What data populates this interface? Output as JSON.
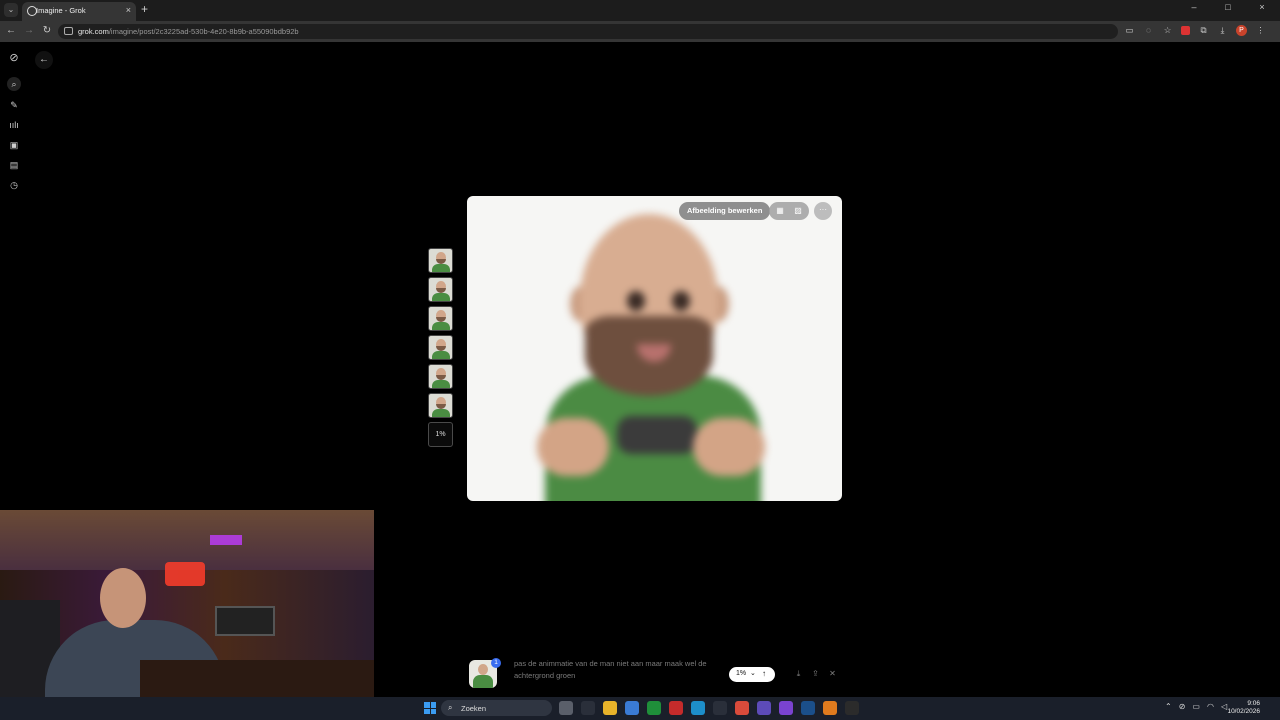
{
  "browser": {
    "tab_title": "Imagine - Grok",
    "tab_menu_icon": "chevron-down",
    "new_tab_icon": "+",
    "tab_close_icon": "×",
    "url_host": "grok.com",
    "url_path": "/imagine/post/2c3225ad-530b-4e20-8b9b-a55090bdb92b",
    "window_controls": [
      "–",
      "□",
      "×"
    ],
    "profile_initial": "P"
  },
  "nav": {
    "back": "←",
    "forward": "→",
    "reload": "↻"
  },
  "grok_rail": [
    "grok-logo",
    "search",
    "new-chat",
    "voice",
    "imagine",
    "projects",
    "history"
  ],
  "back_button": "←",
  "thumbnails": {
    "count": 6,
    "progress_label": "1%"
  },
  "card": {
    "edit_label": "Afbeelding bewerken",
    "more_label": "···",
    "mode_icons": [
      "video-mode",
      "image-mode"
    ]
  },
  "prompt": {
    "badge": "1",
    "text": "pas de animmatie van  de man  niet aan maar maak wel de achtergrond groen",
    "percent": "1%",
    "actions": [
      "download",
      "share",
      "close"
    ]
  },
  "taskbar": {
    "search_label": "Zoeken",
    "time": "9:06",
    "date": "10/02/2026",
    "apps": [
      {
        "name": "task-view",
        "color": "#5a5f6a"
      },
      {
        "name": "steam-like",
        "color": "#2a2f3a"
      },
      {
        "name": "file-explorer",
        "color": "#e8b32a"
      },
      {
        "name": "store",
        "color": "#3a7bd5"
      },
      {
        "name": "xbox",
        "color": "#1f8f3a"
      },
      {
        "name": "app-red",
        "color": "#c42b2b"
      },
      {
        "name": "edge",
        "color": "#1d8ec9"
      },
      {
        "name": "app-x",
        "color": "#2a2f3a"
      },
      {
        "name": "chrome",
        "color": "#d94b3b"
      },
      {
        "name": "app-purple",
        "color": "#5d4bb8"
      },
      {
        "name": "app-cam",
        "color": "#7a43d0"
      },
      {
        "name": "steam",
        "color": "#1b4f8a"
      },
      {
        "name": "app-orange",
        "color": "#e07b1e"
      },
      {
        "name": "app-last",
        "color": "#2b2b2b"
      }
    ]
  },
  "colors": {
    "accent_blue": "#3a6df0",
    "card_bg": "#f6f6f4",
    "page_bg": "#000000"
  }
}
